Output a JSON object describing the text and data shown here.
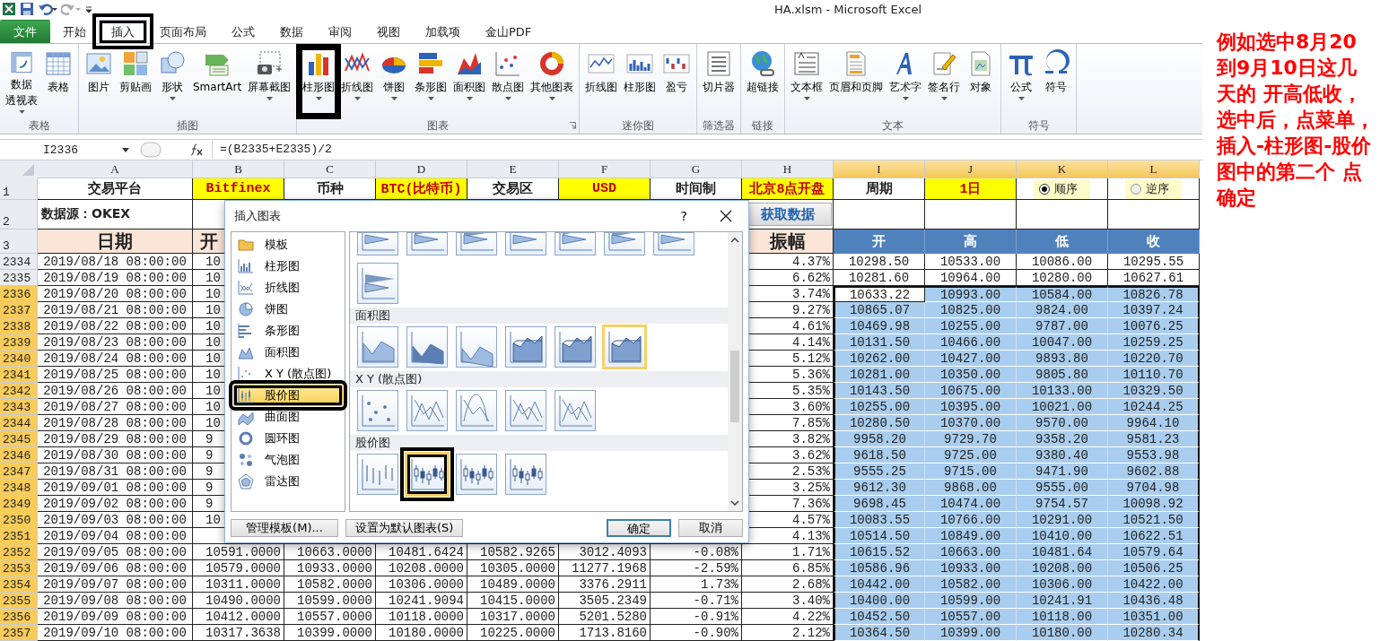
{
  "title_bar": {
    "title": "HA.xlsm  -  Microsoft Excel"
  },
  "ribbon": {
    "tabs": [
      {
        "label": "文件",
        "kind": "file",
        "selected": false,
        "annotated": false
      },
      {
        "label": "开始",
        "kind": "tab",
        "selected": false,
        "annotated": false
      },
      {
        "label": "插入",
        "kind": "tab",
        "selected": true,
        "annotated": true
      },
      {
        "label": "页面布局",
        "kind": "tab",
        "selected": false,
        "annotated": false
      },
      {
        "label": "公式",
        "kind": "tab",
        "selected": false,
        "annotated": false
      },
      {
        "label": "数据",
        "kind": "tab",
        "selected": false,
        "annotated": false
      },
      {
        "label": "审阅",
        "kind": "tab",
        "selected": false,
        "annotated": false
      },
      {
        "label": "视图",
        "kind": "tab",
        "selected": false,
        "annotated": false
      },
      {
        "label": "加载项",
        "kind": "tab",
        "selected": false,
        "annotated": false
      },
      {
        "label": "金山PDF",
        "kind": "tab",
        "selected": false,
        "annotated": false
      }
    ],
    "groups": [
      {
        "label": "表格",
        "launcher": false,
        "buttons": [
          {
            "label": "数据",
            "label_2": "透视表",
            "dropdown": true,
            "annotated": false
          },
          {
            "label": "表格",
            "dropdown": false,
            "annotated": false
          }
        ]
      },
      {
        "label": "插图",
        "launcher": false,
        "buttons": [
          {
            "label": "图片",
            "dropdown": false,
            "annotated": false
          },
          {
            "label": "剪贴画",
            "dropdown": false,
            "annotated": false
          },
          {
            "label": "形状",
            "dropdown": true,
            "annotated": false
          },
          {
            "label": "SmartArt",
            "dropdown": false,
            "annotated": false
          },
          {
            "label": "屏幕截图",
            "dropdown": true,
            "annotated": false
          }
        ]
      },
      {
        "label": "图表",
        "launcher": true,
        "buttons": [
          {
            "label": "柱形图",
            "dropdown": true,
            "annotated": true
          },
          {
            "label": "折线图",
            "dropdown": true,
            "annotated": false
          },
          {
            "label": "饼图",
            "dropdown": true,
            "annotated": false
          },
          {
            "label": "条形图",
            "dropdown": true,
            "annotated": false
          },
          {
            "label": "面积图",
            "dropdown": true,
            "annotated": false
          },
          {
            "label": "散点图",
            "dropdown": true,
            "annotated": false
          },
          {
            "label": "其他图表",
            "dropdown": true,
            "annotated": false
          }
        ]
      },
      {
        "label": "迷你图",
        "launcher": false,
        "buttons": [
          {
            "label": "折线图",
            "dropdown": false,
            "annotated": false
          },
          {
            "label": "柱形图",
            "dropdown": false,
            "annotated": false
          },
          {
            "label": "盈亏",
            "dropdown": false,
            "annotated": false
          }
        ]
      },
      {
        "label": "筛选器",
        "launcher": false,
        "buttons": [
          {
            "label": "切片器",
            "dropdown": false,
            "annotated": false
          }
        ]
      },
      {
        "label": "链接",
        "launcher": false,
        "buttons": [
          {
            "label": "超链接",
            "dropdown": false,
            "annotated": false
          }
        ]
      },
      {
        "label": "文本",
        "launcher": false,
        "buttons": [
          {
            "label": "文本框",
            "dropdown": true,
            "annotated": false
          },
          {
            "label": "页眉和页脚",
            "dropdown": false,
            "annotated": false
          },
          {
            "label": "艺术字",
            "dropdown": true,
            "annotated": false
          },
          {
            "label": "签名行",
            "dropdown": true,
            "annotated": false
          },
          {
            "label": "对象",
            "dropdown": false,
            "annotated": false
          }
        ]
      },
      {
        "label": "符号",
        "launcher": false,
        "buttons": [
          {
            "label": "公式",
            "dropdown": true,
            "annotated": false
          },
          {
            "label": "符号",
            "dropdown": false,
            "annotated": false
          }
        ]
      }
    ]
  },
  "formula_bar": {
    "name_box": "I2336",
    "formula": "=(B2335+E2335)/2"
  },
  "sheet": {
    "columns": [
      {
        "label": "A",
        "selected": false
      },
      {
        "label": "B",
        "selected": false
      },
      {
        "label": "C",
        "selected": false
      },
      {
        "label": "D",
        "selected": false
      },
      {
        "label": "E",
        "selected": false
      },
      {
        "label": "F",
        "selected": false
      },
      {
        "label": "G",
        "selected": false
      },
      {
        "label": "H",
        "selected": false
      },
      {
        "label": "I",
        "selected": true
      },
      {
        "label": "J",
        "selected": true
      },
      {
        "label": "K",
        "selected": true
      },
      {
        "label": "L",
        "selected": true
      }
    ],
    "header_rows": [
      {
        "num": "1",
        "cells": [
          {
            "text": "交易平台",
            "kind": "label"
          },
          {
            "text": "Bitfinex",
            "kind": "value"
          },
          {
            "text": "币种",
            "kind": "label"
          },
          {
            "text": "BTC(比特币)",
            "kind": "value"
          },
          {
            "text": "交易区",
            "kind": "label"
          },
          {
            "text": "USD",
            "kind": "value"
          },
          {
            "text": "时间制",
            "kind": "label"
          },
          {
            "text": "北京8点开盘",
            "kind": "value"
          },
          {
            "text": "周期",
            "kind": "label"
          },
          {
            "text": "1日",
            "kind": "value"
          },
          {
            "text": "顺序",
            "kind": "radio",
            "selected": true
          },
          {
            "text": "逆序",
            "kind": "radio",
            "selected": false
          }
        ]
      },
      {
        "num": "2",
        "cells": [
          {
            "text": "数据源：OKEX",
            "kind": "source"
          },
          null,
          null,
          null,
          null,
          null,
          null,
          {
            "text": "获取数据",
            "kind": "button"
          },
          null,
          null,
          null,
          null
        ]
      },
      {
        "num": "3",
        "cells": [
          {
            "text": "日期",
            "kind": "head"
          },
          {
            "text": "开",
            "kind": "head-cut"
          },
          null,
          null,
          null,
          null,
          null,
          {
            "text": "振幅",
            "kind": "head"
          },
          {
            "text": "开",
            "kind": "ohlc-head"
          },
          {
            "text": "高",
            "kind": "ohlc-head"
          },
          {
            "text": "低",
            "kind": "ohlc-head"
          },
          {
            "text": "收",
            "kind": "ohlc-head"
          }
        ]
      }
    ],
    "rows": [
      {
        "num": "2334",
        "selected": false,
        "active": false,
        "cells": [
          "2019/08/18 08:00:00",
          "10",
          null,
          null,
          null,
          null,
          null,
          "4.37%",
          "10298.50",
          "10533.00",
          "10086.00",
          "10295.55"
        ]
      },
      {
        "num": "2335",
        "selected": false,
        "active": false,
        "cells": [
          "2019/08/19 08:00:00",
          "10",
          null,
          null,
          null,
          null,
          null,
          "6.62%",
          "10281.60",
          "10964.00",
          "10280.00",
          "10627.61"
        ]
      },
      {
        "num": "2336",
        "selected": true,
        "active": true,
        "cells": [
          "2019/08/20 08:00:00",
          "10",
          null,
          null,
          null,
          null,
          null,
          "3.74%",
          "10633.22",
          "10993.00",
          "10584.00",
          "10826.78"
        ]
      },
      {
        "num": "2337",
        "selected": true,
        "active": false,
        "cells": [
          "2019/08/21 08:00:00",
          "10",
          null,
          null,
          null,
          null,
          null,
          "9.27%",
          "10865.07",
          "10825.00",
          "9824.00",
          "10397.24"
        ]
      },
      {
        "num": "2338",
        "selected": true,
        "active": false,
        "cells": [
          "2019/08/22 08:00:00",
          "10",
          null,
          null,
          null,
          null,
          null,
          "4.61%",
          "10469.98",
          "10255.00",
          "9787.00",
          "10076.25"
        ]
      },
      {
        "num": "2339",
        "selected": true,
        "active": false,
        "cells": [
          "2019/08/23 08:00:00",
          "10",
          null,
          null,
          null,
          null,
          null,
          "4.14%",
          "10131.50",
          "10466.00",
          "10047.00",
          "10259.25"
        ]
      },
      {
        "num": "2340",
        "selected": true,
        "active": false,
        "cells": [
          "2019/08/24 08:00:00",
          "10",
          null,
          null,
          null,
          null,
          null,
          "5.12%",
          "10262.00",
          "10427.00",
          "9893.80",
          "10220.70"
        ]
      },
      {
        "num": "2341",
        "selected": true,
        "active": false,
        "cells": [
          "2019/08/25 08:00:00",
          "10",
          null,
          null,
          null,
          null,
          null,
          "5.36%",
          "10281.00",
          "10350.00",
          "9805.80",
          "10110.70"
        ]
      },
      {
        "num": "2342",
        "selected": true,
        "active": false,
        "cells": [
          "2019/08/26 08:00:00",
          "10",
          null,
          null,
          null,
          null,
          null,
          "5.35%",
          "10143.50",
          "10675.00",
          "10133.00",
          "10329.50"
        ]
      },
      {
        "num": "2343",
        "selected": true,
        "active": false,
        "cells": [
          "2019/08/27 08:00:00",
          "10",
          null,
          null,
          null,
          null,
          null,
          "3.60%",
          "10255.00",
          "10395.00",
          "10021.00",
          "10244.25"
        ]
      },
      {
        "num": "2344",
        "selected": true,
        "active": false,
        "cells": [
          "2019/08/28 08:00:00",
          "10",
          null,
          null,
          null,
          null,
          null,
          "7.85%",
          "10280.50",
          "10370.00",
          "9570.00",
          "9964.10"
        ]
      },
      {
        "num": "2345",
        "selected": true,
        "active": false,
        "cells": [
          "2019/08/29 08:00:00",
          "9",
          null,
          null,
          null,
          null,
          null,
          "3.82%",
          "9958.20",
          "9729.70",
          "9358.20",
          "9581.23"
        ]
      },
      {
        "num": "2346",
        "selected": true,
        "active": false,
        "cells": [
          "2019/08/30 08:00:00",
          "9",
          null,
          null,
          null,
          null,
          null,
          "3.62%",
          "9618.50",
          "9725.00",
          "9380.40",
          "9553.98"
        ]
      },
      {
        "num": "2347",
        "selected": true,
        "active": false,
        "cells": [
          "2019/08/31 08:00:00",
          "9",
          null,
          null,
          null,
          null,
          null,
          "2.53%",
          "9555.25",
          "9715.00",
          "9471.90",
          "9602.88"
        ]
      },
      {
        "num": "2348",
        "selected": true,
        "active": false,
        "cells": [
          "2019/09/01 08:00:00",
          "9",
          null,
          null,
          null,
          null,
          null,
          "3.25%",
          "9612.30",
          "9868.00",
          "9555.00",
          "9704.98"
        ]
      },
      {
        "num": "2349",
        "selected": true,
        "active": false,
        "cells": [
          "2019/09/02 08:00:00",
          "9",
          null,
          null,
          null,
          null,
          null,
          "7.36%",
          "9698.45",
          "10474.00",
          "9754.57",
          "10098.92"
        ]
      },
      {
        "num": "2350",
        "selected": true,
        "active": false,
        "cells": [
          "2019/09/03 08:00:00",
          "10",
          null,
          null,
          null,
          null,
          null,
          "4.57%",
          "10083.55",
          "10766.00",
          "10291.00",
          "10521.50"
        ]
      },
      {
        "num": "2351",
        "selected": true,
        "active": false,
        "cells": [
          "2019/09/04 08:00:00",
          null,
          null,
          null,
          null,
          null,
          null,
          "4.13%",
          "10514.50",
          "10849.00",
          "10410.00",
          "10622.51"
        ]
      },
      {
        "num": "2352",
        "selected": true,
        "active": false,
        "cells": [
          "2019/09/05 08:00:00",
          "10591.0000",
          "10663.0000",
          "10481.6424",
          "10582.9265",
          "3012.4093",
          "-0.08%",
          "1.71%",
          "10615.52",
          "10663.00",
          "10481.64",
          "10579.64"
        ]
      },
      {
        "num": "2353",
        "selected": true,
        "active": false,
        "cells": [
          "2019/09/06 08:00:00",
          "10579.0000",
          "10933.0000",
          "10208.0000",
          "10305.0000",
          "11277.1968",
          "-2.59%",
          "6.85%",
          "10586.96",
          "10933.00",
          "10208.00",
          "10506.25"
        ]
      },
      {
        "num": "2354",
        "selected": true,
        "active": false,
        "cells": [
          "2019/09/07 08:00:00",
          "10311.0000",
          "10582.0000",
          "10306.0000",
          "10489.0000",
          "3376.2911",
          "1.73%",
          "2.68%",
          "10442.00",
          "10582.00",
          "10306.00",
          "10422.00"
        ]
      },
      {
        "num": "2355",
        "selected": true,
        "active": false,
        "cells": [
          "2019/09/08 08:00:00",
          "10490.0000",
          "10599.0000",
          "10241.9094",
          "10415.0000",
          "3505.2349",
          "-0.71%",
          "3.40%",
          "10400.00",
          "10599.00",
          "10241.91",
          "10436.48"
        ]
      },
      {
        "num": "2356",
        "selected": true,
        "active": false,
        "cells": [
          "2019/09/09 08:00:00",
          "10412.0000",
          "10557.0000",
          "10118.0000",
          "10317.0000",
          "5201.5280",
          "-0.91%",
          "4.22%",
          "10452.50",
          "10557.00",
          "10118.00",
          "10351.00"
        ]
      },
      {
        "num": "2357",
        "selected": true,
        "active": false,
        "cells": [
          "2019/09/10 08:00:00",
          "10317.3638",
          "10399.0000",
          "10180.0000",
          "10225.0000",
          "1713.8160",
          "-0.90%",
          "2.12%",
          "10364.50",
          "10399.00",
          "10180.00",
          "10280.34"
        ]
      }
    ]
  },
  "dialog": {
    "title": "插入图表",
    "help": "?",
    "categories": [
      {
        "label": "模板",
        "selected": false,
        "annotated": false
      },
      {
        "label": "柱形图",
        "selected": false,
        "annotated": false
      },
      {
        "label": "折线图",
        "selected": false,
        "annotated": false
      },
      {
        "label": "饼图",
        "selected": false,
        "annotated": false
      },
      {
        "label": "条形图",
        "selected": false,
        "annotated": false
      },
      {
        "label": "面积图",
        "selected": false,
        "annotated": false
      },
      {
        "label": "X Y (散点图)",
        "selected": false,
        "annotated": false
      },
      {
        "label": "股价图",
        "selected": true,
        "annotated": true
      },
      {
        "label": "曲面图",
        "selected": false,
        "annotated": false
      },
      {
        "label": "圆环图",
        "selected": false,
        "annotated": false
      },
      {
        "label": "气泡图",
        "selected": false,
        "annotated": false
      },
      {
        "label": "雷达图",
        "selected": false,
        "annotated": false
      }
    ],
    "gallery": [
      {
        "kind": "cone",
        "thumbs": [
          {
            "selected": false,
            "annotated": false
          },
          {
            "selected": false,
            "annotated": false
          },
          {
            "selected": false,
            "annotated": false
          },
          {
            "selected": false,
            "annotated": false
          },
          {
            "selected": false,
            "annotated": false
          },
          {
            "selected": false,
            "annotated": false
          },
          {
            "selected": false,
            "annotated": false
          },
          {
            "selected": false,
            "annotated": false
          }
        ]
      },
      {
        "title": "面积图",
        "kind": "area",
        "thumbs": [
          {
            "selected": false,
            "annotated": false
          },
          {
            "selected": false,
            "annotated": false
          },
          {
            "selected": false,
            "annotated": false
          },
          {
            "selected": false,
            "annotated": false
          },
          {
            "selected": false,
            "annotated": false
          },
          {
            "selected": true,
            "annotated": false
          }
        ]
      },
      {
        "title": "X Y (散点图)",
        "kind": "scatter",
        "thumbs": [
          {
            "selected": false,
            "annotated": false
          },
          {
            "selected": false,
            "annotated": false
          },
          {
            "selected": false,
            "annotated": false
          },
          {
            "selected": false,
            "annotated": false
          },
          {
            "selected": false,
            "annotated": false
          }
        ]
      },
      {
        "title": "股价图",
        "kind": "stock",
        "thumbs": [
          {
            "selected": false,
            "annotated": false
          },
          {
            "selected": true,
            "annotated": true
          },
          {
            "selected": false,
            "annotated": false
          },
          {
            "selected": false,
            "annotated": false
          }
        ]
      }
    ],
    "buttons": [
      {
        "label": "管理模板(M)...",
        "kind": "left"
      },
      {
        "label": "设置为默认图表(S)",
        "kind": "left"
      },
      {
        "label": "确定",
        "kind": "default"
      },
      {
        "label": "取消",
        "kind": "normal"
      }
    ]
  },
  "annotation": {
    "text": "例如选中**8**月**20**到**9**月**10**日这几天的 开高低收，选中后，点菜单，插入-柱形图-股价图中的第二个 点确定"
  }
}
